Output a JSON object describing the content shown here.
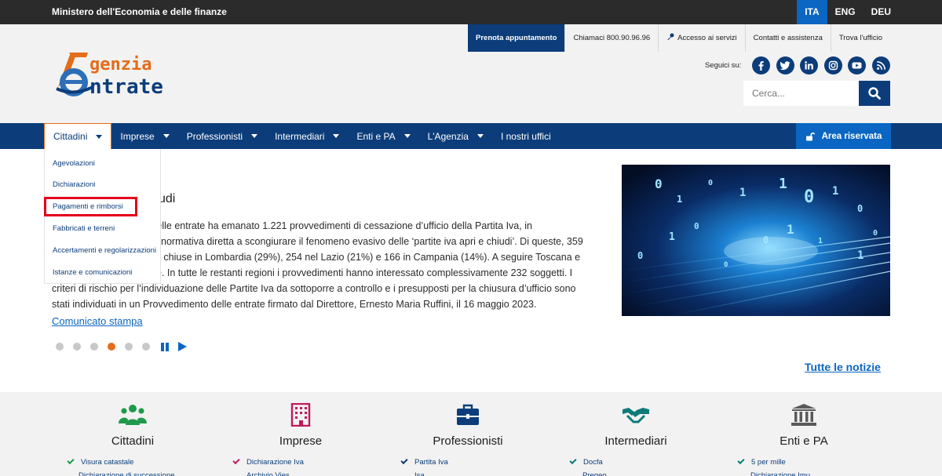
{
  "topbar": {
    "ministry": "Ministero dell'Economia e delle finanze",
    "languages": [
      {
        "label": "ITA",
        "active": true
      },
      {
        "label": "ENG",
        "active": false
      },
      {
        "label": "DEU",
        "active": false
      }
    ]
  },
  "header": {
    "logo": {
      "line1": "genzia",
      "line2": "ntrate"
    },
    "util": {
      "prenota": "Prenota appuntamento",
      "chiamaci": "Chiamaci 800.90.96.96",
      "accesso": "Accesso ai servizi",
      "contatti": "Contatti e assistenza",
      "trova": "Trova l'ufficio"
    },
    "seguici": "Seguici su:",
    "social_icons": [
      "facebook-icon",
      "twitter-icon",
      "linkedin-icon",
      "instagram-icon",
      "youtube-icon",
      "rss-icon"
    ],
    "search_placeholder": "Cerca..."
  },
  "nav": {
    "items": [
      "Cittadini",
      "Imprese",
      "Professionisti",
      "Intermediari",
      "Enti e PA",
      "L'Agenzia",
      "I nostri uffici"
    ],
    "area_riservata": "Area riservata"
  },
  "dropdown": {
    "items": [
      "Agevolazioni",
      "Dichiarazioni",
      "Pagamenti e rimborsi",
      "Fabbricati e terreni",
      "Accertamenti e regolarizzazioni",
      "Istanze e comunicazioni"
    ]
  },
  "news": {
    "title_visible": "udi",
    "lines": [
      "zia delle entrate ha emanato 1.221 provvedimenti di cessazione d’ufficio della Partita Iva, in",
      "normativa diretta a scongiurare il fenomeno evasivo delle ‘partite iva apri e chiudi’. Di queste, 359",
      "e chiuse in Lombardia (29%), 254 nel Lazio (21%) e 166 in Campania (14%). A seguire Toscana e",
      "e. In tutte le restanti regioni i provvedimenti hanno interessato complessivamente 232 soggetti. I",
      "criteri di rischio per l’individuazione delle Partite Iva da sottoporre a controllo e i presupposti per la chiusura d’ufficio sono",
      "stati individuati in un Provvedimento delle entrate firmato dal Direttore, Ernesto Maria Ruffini, il 16 maggio 2023."
    ],
    "link": "Comunicato stampa",
    "carousel_active_index": 3,
    "carousel_count": 6
  },
  "tutte_notizie": "Tutte le notizie",
  "bottom": {
    "columns": [
      {
        "title": "Cittadini",
        "icon": "users-icon",
        "color": "#1f9a4b",
        "link": "Visura catastale",
        "link2": "Dichiarazione di successione"
      },
      {
        "title": "Imprese",
        "icon": "building-icon",
        "color": "#c2185b",
        "link": "Dichiarazione Iva",
        "link2": "Archivio Vies"
      },
      {
        "title": "Professionisti",
        "icon": "briefcase-icon",
        "color": "#0c3d7a",
        "link": "Partita Iva",
        "link2": "Isa"
      },
      {
        "title": "Intermediari",
        "icon": "handshake-icon",
        "color": "#0f7a7a",
        "link": "Docfa",
        "link2": "Pregeo"
      },
      {
        "title": "Enti e PA",
        "icon": "institution-icon",
        "color": "#5a5a5a",
        "link": "5 per mille",
        "link2": "Dichiarazione Imu"
      }
    ]
  },
  "colors": {
    "primary": "#0c3d7a",
    "accent": "#0a66c2",
    "orange": "#e46c1a",
    "highlight": "#e4001b"
  }
}
